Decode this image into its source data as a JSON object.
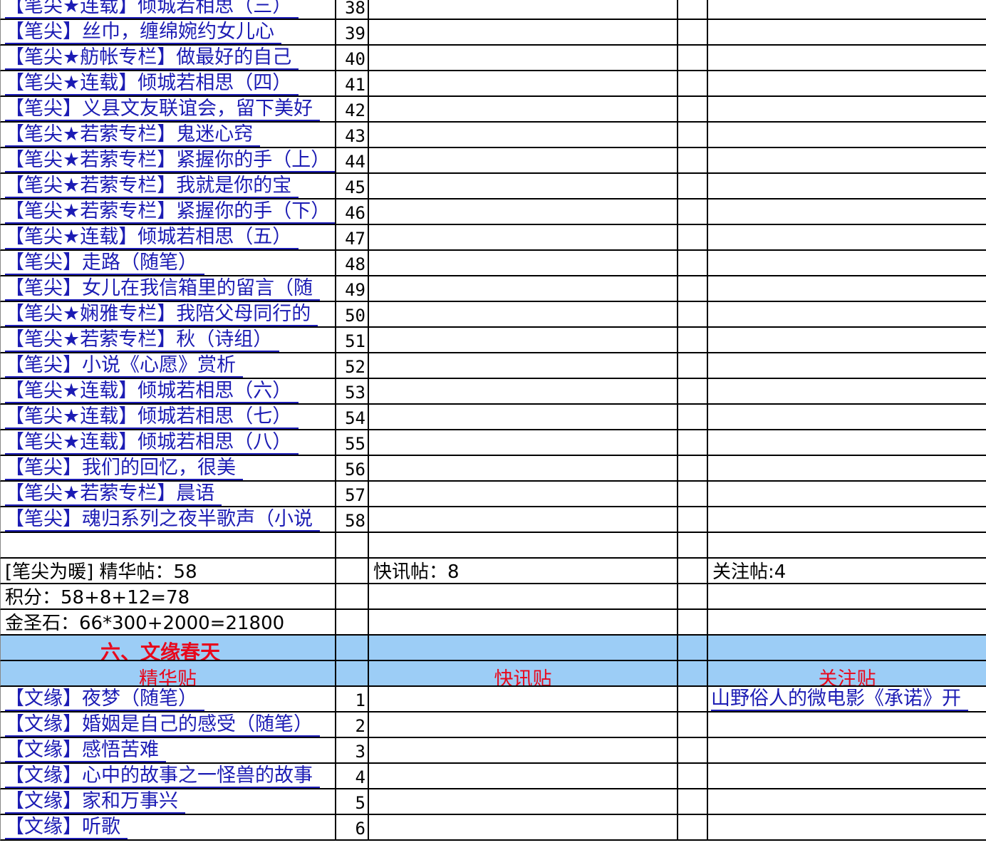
{
  "section5": {
    "rows": [
      {
        "title": "【笔尖★连载】倾城若相思（三）",
        "num": "38"
      },
      {
        "title": "【笔尖】丝巾，缠绵婉约女儿心",
        "num": "39"
      },
      {
        "title": "【笔尖★舫帐专栏】做最好的自己",
        "num": "40"
      },
      {
        "title": "【笔尖★连载】倾城若相思（四）",
        "num": "41"
      },
      {
        "title": "【笔尖】义县文友联谊会，留下美好",
        "num": "42"
      },
      {
        "title": "【笔尖★若萦专栏】鬼迷心窍",
        "num": "43"
      },
      {
        "title": "【笔尖★若萦专栏】紧握你的手（上）",
        "num": "44"
      },
      {
        "title": "【笔尖★若萦专栏】我就是你的宝",
        "num": "45"
      },
      {
        "title": "【笔尖★若萦专栏】紧握你的手（下）",
        "num": "46"
      },
      {
        "title": "【笔尖★连载】倾城若相思（五）",
        "num": "47"
      },
      {
        "title": "【笔尖】走路（随笔）",
        "num": "48"
      },
      {
        "title": "【笔尖】女儿在我信箱里的留言（随",
        "num": "49"
      },
      {
        "title": "【笔尖★娴雅专栏】我陪父母同行的",
        "num": "50"
      },
      {
        "title": "【笔尖★若萦专栏】秋（诗组）",
        "num": "51"
      },
      {
        "title": "【笔尖】小说《心愿》赏析",
        "num": "52"
      },
      {
        "title": "【笔尖★连载】倾城若相思（六）",
        "num": "53"
      },
      {
        "title": "【笔尖★连载】倾城若相思（七）",
        "num": "54"
      },
      {
        "title": "【笔尖★连载】倾城若相思（八）",
        "num": "55"
      },
      {
        "title": "【笔尖】我们的回忆，很美",
        "num": "56"
      },
      {
        "title": "【笔尖★若萦专栏】晨语",
        "num": "57"
      },
      {
        "title": "【笔尖】魂归系列之夜半歌声（小说",
        "num": "58"
      }
    ],
    "summary": {
      "jinghua": "[笔尖为暖]  精华帖：58",
      "kuaixun": "快讯帖：8",
      "guanzhu": "关注帖:4",
      "score": "积分：58+8+12=78",
      "stones": "金圣石：66*300+2000=21800"
    }
  },
  "section6": {
    "title": "六、文缘春天",
    "headers": {
      "jinghua": "精华贴",
      "kuaixun": "快讯贴",
      "guanzhu": "关注贴"
    },
    "rows": [
      {
        "title": "【文缘】夜梦（随笔）",
        "num": "1",
        "guanzhu": "山野俗人的微电影《承诺》开"
      },
      {
        "title": "【文缘】婚姻是自己的感受（随笔）",
        "num": "2",
        "guanzhu": ""
      },
      {
        "title": "【文缘】感悟苦难",
        "num": "3",
        "guanzhu": ""
      },
      {
        "title": "【文缘】心中的故事之一怪兽的故事",
        "num": "4",
        "guanzhu": ""
      },
      {
        "title": "【文缘】家和万事兴",
        "num": "5",
        "guanzhu": ""
      },
      {
        "title": "【文缘】听歌",
        "num": "6",
        "guanzhu": ""
      }
    ]
  },
  "colors": {
    "link": "#1c1cb4",
    "header_bg": "#9ccdf6",
    "header_text": "#e8081c"
  }
}
